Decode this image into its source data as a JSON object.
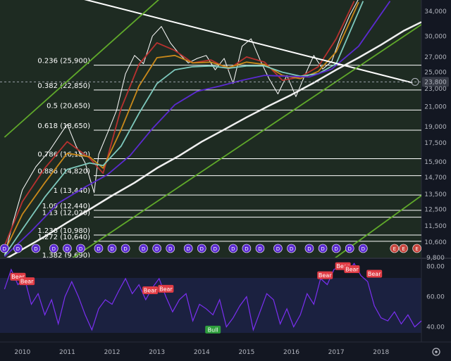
{
  "chart_data": [
    {
      "type": "line",
      "panel": "price",
      "scale": "log",
      "ylim": [
        9800,
        36000
      ],
      "xlim": [
        2009.5,
        2018.9
      ],
      "y_ticks": [
        "34,000",
        "30,000",
        "27,000",
        "25,000",
        "23,000",
        "21,000",
        "19,000",
        "17,500",
        "15,900",
        "14,700",
        "13,500",
        "12,500",
        "11,500",
        "10,600",
        "9,800"
      ],
      "y_tick_values": [
        34000,
        30000,
        27000,
        25000,
        23000,
        21000,
        19000,
        17500,
        15900,
        14700,
        13500,
        12500,
        11500,
        10600,
        9800
      ],
      "current_price_label": "23,800",
      "current_price": 23800,
      "fib_levels": [
        {
          "label": "0.236 (25,900)",
          "value": 25900
        },
        {
          "label": "0.382 (22,850)",
          "value": 22850
        },
        {
          "label": "0.5 (20,650)",
          "value": 20650
        },
        {
          "label": "0.618 (18,650)",
          "value": 18650
        },
        {
          "label": "0.786 (16,150)",
          "value": 16150
        },
        {
          "label": "0.886 (14,820)",
          "value": 14820
        },
        {
          "label": "1 (13,440)",
          "value": 13440
        },
        {
          "label": "1.09 (12,440)",
          "value": 12440
        },
        {
          "label": "1.13 (12,020)",
          "value": 12020
        },
        {
          "label": "1.236 (10,980)",
          "value": 10980
        },
        {
          "label": "1.272 (10,640)",
          "value": 10640
        },
        {
          "label": "1.382 (9,690)",
          "value": 9690
        }
      ],
      "series": [
        {
          "role": "price",
          "color": "#ffffff",
          "x": [
            2009.6,
            2009.8,
            2010.0,
            2010.3,
            2010.6,
            2010.9,
            2011.0,
            2011.2,
            2011.4,
            2011.6,
            2011.7,
            2011.9,
            2012.1,
            2012.3,
            2012.5,
            2012.7,
            2012.9,
            2013.1,
            2013.3,
            2013.5,
            2013.7,
            2013.9,
            2014.1,
            2014.3,
            2014.5,
            2014.7,
            2014.9,
            2015.1,
            2015.3,
            2015.5,
            2015.7,
            2015.9,
            2016.1,
            2016.3,
            2016.5,
            2016.7,
            2016.9,
            2017.1,
            2017.3,
            2017.5
          ],
          "y": [
            9900,
            11800,
            13800,
            15500,
            16800,
            18600,
            19200,
            17200,
            15800,
            13600,
            16500,
            18400,
            20600,
            24800,
            27200,
            26100,
            30000,
            31500,
            29000,
            27400,
            26200,
            26800,
            27200,
            25300,
            26800,
            23600,
            28500,
            29600,
            26600,
            24200,
            22400,
            24600,
            22100,
            24600,
            27200,
            25400,
            26400,
            30000,
            33300,
            36200
          ]
        },
        {
          "role": "ma-red",
          "color": "#b8312f",
          "x": [
            2009.6,
            2010.0,
            2010.5,
            2011.0,
            2011.5,
            2011.8,
            2012.2,
            2012.6,
            2013.0,
            2013.4,
            2013.8,
            2014.2,
            2014.6,
            2015.0,
            2015.4,
            2015.8,
            2016.2,
            2016.6,
            2017.0,
            2017.4
          ],
          "y": [
            10400,
            13000,
            15400,
            17600,
            16200,
            15000,
            20800,
            26000,
            29000,
            27900,
            26200,
            26600,
            25400,
            27000,
            26300,
            24000,
            24400,
            25700,
            29600,
            35800
          ]
        },
        {
          "role": "ma-orange",
          "color": "#c9891a",
          "x": [
            2009.6,
            2010.0,
            2010.5,
            2011.0,
            2011.5,
            2011.8,
            2012.2,
            2012.6,
            2013.0,
            2013.4,
            2013.8,
            2014.2,
            2014.6,
            2015.0,
            2015.4,
            2015.8,
            2016.2,
            2016.6,
            2017.0,
            2017.5
          ],
          "y": [
            10100,
            12200,
            14300,
            16600,
            16300,
            15400,
            18700,
            23300,
            26900,
            27200,
            26200,
            26300,
            25600,
            26300,
            26000,
            24600,
            24200,
            25100,
            27700,
            35600
          ]
        },
        {
          "role": "ma-teal",
          "color": "#7ec9bd",
          "x": [
            2009.6,
            2010.0,
            2010.5,
            2011.0,
            2011.5,
            2011.8,
            2012.2,
            2012.6,
            2013.0,
            2013.4,
            2013.8,
            2014.2,
            2014.6,
            2015.0,
            2015.4,
            2015.8,
            2016.2,
            2016.6,
            2017.0,
            2017.6
          ],
          "y": [
            9900,
            11300,
            13300,
            15300,
            15800,
            15600,
            17200,
            20300,
            23600,
            25300,
            25700,
            25800,
            25500,
            25800,
            25800,
            25000,
            24500,
            24800,
            26100,
            35800
          ]
        },
        {
          "role": "ma-purple",
          "color": "#5b2ad1",
          "x": [
            2009.6,
            2010.2,
            2010.8,
            2011.4,
            2011.9,
            2012.4,
            2012.9,
            2013.4,
            2013.9,
            2014.4,
            2014.9,
            2015.4,
            2015.9,
            2016.4,
            2016.9,
            2017.5,
            2018.2
          ],
          "y": [
            9850,
            11200,
            12900,
            14000,
            14900,
            16400,
            18800,
            21200,
            22700,
            23300,
            24000,
            24600,
            24500,
            24400,
            25400,
            28500,
            35800
          ]
        },
        {
          "role": "ma-white",
          "color": "#f0f0f0",
          "x": [
            2009.6,
            2010.5,
            2011.0,
            2011.5,
            2012.0,
            2012.5,
            2013.0,
            2013.5,
            2014.0,
            2014.5,
            2015.0,
            2015.5,
            2016.0,
            2016.5,
            2017.0,
            2017.5,
            2018.0,
            2018.5,
            2018.9
          ],
          "y": [
            9700,
            10900,
            11700,
            12500,
            13400,
            14300,
            15400,
            16400,
            17600,
            18700,
            19900,
            21100,
            22300,
            23700,
            25300,
            26900,
            28700,
            30800,
            32200
          ]
        },
        {
          "role": "trend-line",
          "color": "#ffffff",
          "x": [
            2010.5,
            2018.7
          ],
          "y": [
            38000,
            23700
          ]
        },
        {
          "role": "green-channel-upper",
          "color": "#5fa82a",
          "x": [
            2009.6,
            2013.3
          ],
          "y": [
            18000,
            38000
          ]
        },
        {
          "role": "green-channel-lower",
          "color": "#5fa82a",
          "x": [
            2011.0,
            2018.9
          ],
          "y": [
            9600,
            31800
          ]
        },
        {
          "role": "green-channel-bottom",
          "color": "#5fa82a",
          "x": [
            2016.8,
            2018.9
          ],
          "y": [
            9500,
            13400
          ]
        }
      ],
      "event_markers": {
        "labels": [
          "D",
          "D",
          "D",
          "D",
          "D",
          "D",
          "D",
          "D",
          "D",
          "D",
          "D",
          "D",
          "D",
          "D",
          "D",
          "D",
          "D",
          "D",
          "D",
          "D",
          "D",
          "D",
          "D",
          "D",
          "D",
          "E",
          "E",
          "E"
        ],
        "x": [
          2009.6,
          2009.9,
          2010.3,
          2010.7,
          2011.0,
          2011.3,
          2011.7,
          2012.0,
          2012.3,
          2012.7,
          2013.0,
          2013.3,
          2013.7,
          2014.0,
          2014.3,
          2014.7,
          2015.0,
          2015.3,
          2015.7,
          2016.0,
          2016.4,
          2016.7,
          2017.0,
          2017.3,
          2017.6,
          2018.3,
          2018.5,
          2018.8
        ],
        "colors": {
          "D": "#5b2ad1",
          "E": "#c8463e"
        }
      }
    },
    {
      "type": "line",
      "panel": "rsi",
      "ylim": [
        30,
        85
      ],
      "y_ticks": [
        "80.00",
        "60.00",
        "40.00"
      ],
      "y_tick_values": [
        80,
        60,
        40
      ],
      "band": [
        30,
        70
      ],
      "color": "#7b2ff2",
      "x": [
        2009.6,
        2009.75,
        2009.9,
        2010.05,
        2010.2,
        2010.35,
        2010.5,
        2010.65,
        2010.8,
        2010.95,
        2011.1,
        2011.25,
        2011.4,
        2011.55,
        2011.7,
        2011.85,
        2012.0,
        2012.15,
        2012.3,
        2012.45,
        2012.6,
        2012.75,
        2012.9,
        2013.05,
        2013.2,
        2013.35,
        2013.5,
        2013.65,
        2013.8,
        2013.95,
        2014.1,
        2014.25,
        2014.4,
        2014.55,
        2014.7,
        2014.85,
        2015.0,
        2015.15,
        2015.3,
        2015.45,
        2015.6,
        2015.75,
        2015.9,
        2016.05,
        2016.2,
        2016.35,
        2016.5,
        2016.65,
        2016.8,
        2016.95,
        2017.1,
        2017.25,
        2017.4,
        2017.55,
        2017.7,
        2017.85,
        2018.0,
        2018.15,
        2018.3,
        2018.45,
        2018.6,
        2018.75,
        2018.9
      ],
      "y": [
        65,
        78,
        68,
        72,
        55,
        62,
        48,
        58,
        42,
        60,
        70,
        60,
        48,
        38,
        52,
        58,
        55,
        64,
        72,
        62,
        68,
        58,
        66,
        72,
        60,
        50,
        58,
        62,
        44,
        55,
        52,
        48,
        58,
        40,
        46,
        54,
        60,
        38,
        50,
        62,
        58,
        42,
        52,
        40,
        48,
        62,
        55,
        72,
        68,
        78,
        80,
        76,
        82,
        74,
        70,
        54,
        46,
        44,
        50,
        42,
        48,
        40,
        44
      ],
      "signals": [
        {
          "label": "Bear",
          "x": 2009.9,
          "y": 73
        },
        {
          "label": "Bear",
          "x": 2010.1,
          "y": 70
        },
        {
          "label": "Bear",
          "x": 2012.85,
          "y": 64
        },
        {
          "label": "Bear",
          "x": 2013.2,
          "y": 65
        },
        {
          "label": "Bull",
          "x": 2014.25,
          "y": 38
        },
        {
          "label": "Bear",
          "x": 2016.75,
          "y": 74
        },
        {
          "label": "Bear",
          "x": 2017.15,
          "y": 80
        },
        {
          "label": "Bear",
          "x": 2017.35,
          "y": 78
        },
        {
          "label": "Bear",
          "x": 2017.85,
          "y": 75
        }
      ],
      "signal_colors": {
        "Bear": "#e03c45",
        "Bull": "#2e9e3d"
      }
    }
  ],
  "x_ticks": [
    "2010",
    "2011",
    "2012",
    "2013",
    "2014",
    "2015",
    "2016",
    "2017",
    "2018"
  ],
  "x_tick_values": [
    2010,
    2011,
    2012,
    2013,
    2014,
    2015,
    2016,
    2017,
    2018
  ]
}
